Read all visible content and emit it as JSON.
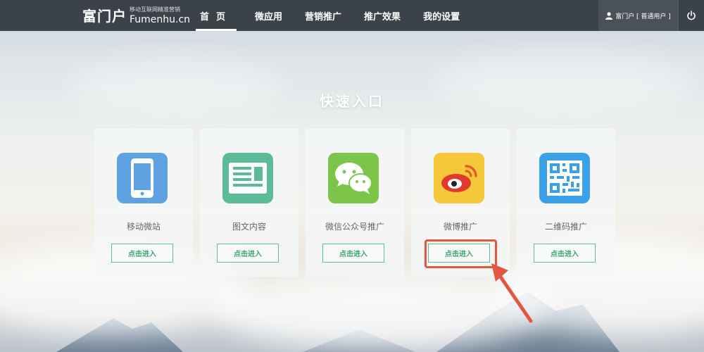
{
  "brand": {
    "name": "富门户",
    "slogan": "移动互联网精准营销",
    "domain": "Fumenhu.cn"
  },
  "nav": {
    "items": [
      {
        "label": "首页",
        "active": true
      },
      {
        "label": "微应用",
        "active": false
      },
      {
        "label": "营销推广",
        "active": false
      },
      {
        "label": "推广效果",
        "active": false
      },
      {
        "label": "我的设置",
        "active": false
      }
    ]
  },
  "user": {
    "label": "富门户 [ 普通用户 ]",
    "icon": "user-icon"
  },
  "power": {
    "icon": "power-icon"
  },
  "main": {
    "title": "快速入口",
    "cards": [
      {
        "label": "移动微站",
        "button": "点击进入",
        "icon": "mobile-phone-icon",
        "color": "#5ea2e2"
      },
      {
        "label": "图文内容",
        "button": "点击进入",
        "icon": "article-icon",
        "color": "#5dbb98"
      },
      {
        "label": "微信公众号推广",
        "button": "点击进入",
        "icon": "wechat-icon",
        "color": "#7dc44a"
      },
      {
        "label": "微博推广",
        "button": "点击进入",
        "icon": "weibo-icon",
        "color": "#f5c83c"
      },
      {
        "label": "二维码推广",
        "button": "点击进入",
        "icon": "qrcode-icon",
        "color": "#3aa0e8"
      }
    ]
  },
  "colors": {
    "topbar": "#3b4249",
    "accent_green": "#5fbf8f",
    "highlight_red": "#e2573f"
  }
}
